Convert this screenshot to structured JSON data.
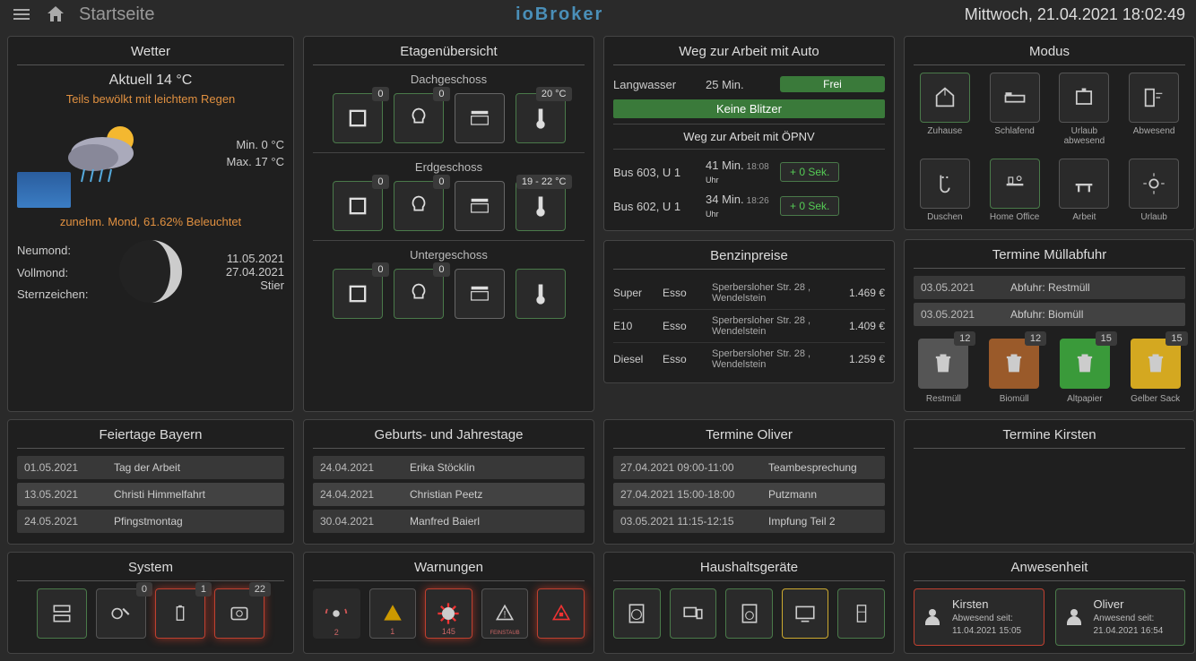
{
  "header": {
    "page_title": "Startseite",
    "logo": "ioBroker",
    "datetime": "Mittwoch, 21.04.2021  18:02:49"
  },
  "weather": {
    "title": "Wetter",
    "current": "Aktuell 14 °C",
    "desc": "Teils bewölkt mit leichtem Regen",
    "min": "Min. 0 °C",
    "max": "Max. 17 °C",
    "moon_text": "zunehm. Mond, 61.62% Beleuchtet",
    "neumond_label": "Neumond:",
    "neumond": "11.05.2021",
    "vollmond_label": "Vollmond:",
    "vollmond": "27.04.2021",
    "stern_label": "Sternzeichen:",
    "stern": "Stier"
  },
  "floors": {
    "title": "Etagenübersicht",
    "levels": [
      {
        "name": "Dachgeschoss",
        "window": "0",
        "light": "0",
        "temp": "20 °C"
      },
      {
        "name": "Erdgeschoss",
        "window": "0",
        "light": "0",
        "temp": "19 - 22 °C"
      },
      {
        "name": "Untergeschoss",
        "window": "0",
        "light": "0",
        "temp": ""
      }
    ]
  },
  "commute": {
    "title": "Weg zur Arbeit mit Auto",
    "dest": "Langwasser",
    "dur": "25 Min.",
    "status": "Frei",
    "blitzer": "Keine Blitzer",
    "title2": "Weg zur Arbeit mit ÖPNV",
    "rows": [
      {
        "line": "Bus 603, U 1",
        "dur": "41 Min.",
        "time": "18:08",
        "uhr": "Uhr",
        "delay": "+ 0 Sek."
      },
      {
        "line": "Bus 602, U 1",
        "dur": "34 Min.",
        "time": "18:26",
        "uhr": "Uhr",
        "delay": "+ 0 Sek."
      }
    ]
  },
  "modus": {
    "title": "Modus",
    "tiles": [
      {
        "label": "Zuhause"
      },
      {
        "label": "Schlafend"
      },
      {
        "label": "Urlaub abwesend"
      },
      {
        "label": "Abwesend"
      },
      {
        "label": "Duschen"
      },
      {
        "label": "Home Office"
      },
      {
        "label": "Arbeit"
      },
      {
        "label": "Urlaub"
      }
    ]
  },
  "benzin": {
    "title": "Benzinpreise",
    "rows": [
      {
        "type": "Super",
        "station": "Esso",
        "addr": "Sperbersloher Str. 28 , Wendelstein",
        "price": "1.469 €"
      },
      {
        "type": "E10",
        "station": "Esso",
        "addr": "Sperbersloher Str. 28 , Wendelstein",
        "price": "1.409 €"
      },
      {
        "type": "Diesel",
        "station": "Esso",
        "addr": "Sperbersloher Str. 28 , Wendelstein",
        "price": "1.259 €"
      }
    ]
  },
  "trash": {
    "title": "Termine Müllabfuhr",
    "rows": [
      {
        "date": "03.05.2021",
        "text": "Abfuhr: Restmüll"
      },
      {
        "date": "03.05.2021",
        "text": "Abfuhr: Biomüll"
      }
    ],
    "bins": [
      {
        "label": "Restmüll",
        "days": "12"
      },
      {
        "label": "Biomüll",
        "days": "12"
      },
      {
        "label": "Altpapier",
        "days": "15"
      },
      {
        "label": "Gelber Sack",
        "days": "15"
      }
    ]
  },
  "holidays": {
    "title": "Feiertage Bayern",
    "rows": [
      {
        "date": "01.05.2021",
        "text": "Tag der Arbeit"
      },
      {
        "date": "13.05.2021",
        "text": "Christi Himmelfahrt"
      },
      {
        "date": "24.05.2021",
        "text": "Pfingstmontag"
      }
    ]
  },
  "birthdays": {
    "title": "Geburts- und Jahrestage",
    "rows": [
      {
        "date": "24.04.2021",
        "text": "Erika Stöcklin"
      },
      {
        "date": "24.04.2021",
        "text": "Christian Peetz"
      },
      {
        "date": "30.04.2021",
        "text": "Manfred Baierl"
      }
    ]
  },
  "oliver": {
    "title": "Termine Oliver",
    "rows": [
      {
        "date": "27.04.2021 09:00-11:00",
        "text": "Teambesprechung"
      },
      {
        "date": "27.04.2021 15:00-18:00",
        "text": "Putzmann"
      },
      {
        "date": "03.05.2021 11:15-12:15",
        "text": "Impfung Teil 2"
      }
    ]
  },
  "kirsten": {
    "title": "Termine Kirsten"
  },
  "system": {
    "title": "System",
    "tiles": [
      {
        "badge": ""
      },
      {
        "badge": "0"
      },
      {
        "badge": "1"
      },
      {
        "badge": "22"
      }
    ]
  },
  "warnungen": {
    "title": "Warnungen",
    "tiles": [
      {
        "sub": "2"
      },
      {
        "sub": "1"
      },
      {
        "sub": "145"
      },
      {
        "sub": "FEINSTAUB"
      },
      {
        "sub": ""
      }
    ]
  },
  "haushalt": {
    "title": "Haushaltsgeräte"
  },
  "anwesen": {
    "title": "Anwesenheit",
    "people": [
      {
        "name": "Kirsten",
        "status": "Abwesend seit:",
        "time": "11.04.2021 15:05"
      },
      {
        "name": "Oliver",
        "status": "Anwesend seit:",
        "time": "21.04.2021 16:54"
      }
    ]
  }
}
